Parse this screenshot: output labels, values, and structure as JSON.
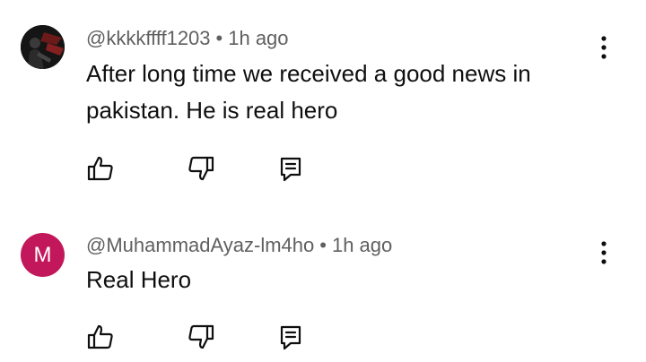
{
  "comments": [
    {
      "author": "@kkkkffff1203",
      "separator": "•",
      "time": "1h ago",
      "text": "After long time we received a good news in pakistan. He is real hero",
      "avatar_type": "photo"
    },
    {
      "author": "@MuhammadAyaz-lm4ho",
      "separator": "•",
      "time": "1h ago",
      "text": "Real Hero",
      "avatar_type": "letter",
      "avatar_letter": "M",
      "avatar_color": "#c2185b"
    }
  ],
  "icons": {
    "like": "thumbs-up-icon",
    "dislike": "thumbs-down-icon",
    "reply": "reply-icon",
    "menu": "more-vert-icon"
  },
  "colors": {
    "meta_text": "#606060",
    "body_text": "#0f0f0f",
    "icon": "#0f0f0f"
  }
}
